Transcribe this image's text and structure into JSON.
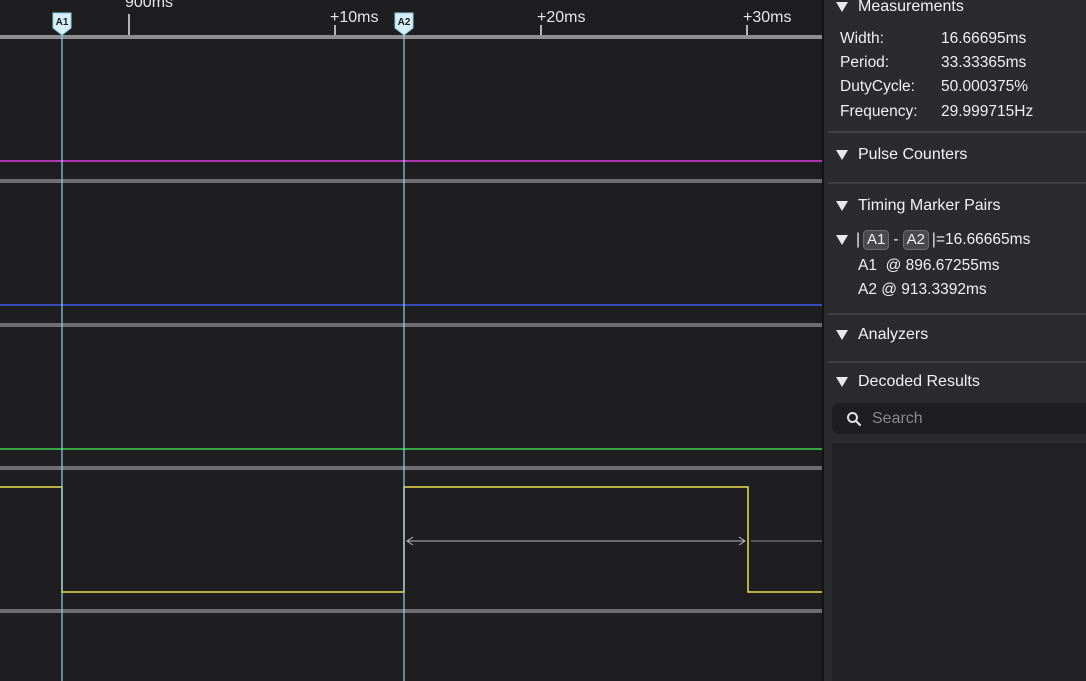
{
  "timeline": {
    "ticks": [
      "900ms",
      "+10ms",
      "+20ms",
      "+30ms"
    ],
    "markers": [
      "A1",
      "A2"
    ]
  },
  "channels": {
    "colors": [
      "#e23ee8",
      "#3d5ce8",
      "#3fd04a",
      "#e8e04a"
    ]
  },
  "panel": {
    "measurements": {
      "title": "Measurements",
      "rows": [
        {
          "label": "Width:",
          "value": "16.66695ms"
        },
        {
          "label": "Period:",
          "value": "33.33365ms"
        },
        {
          "label": "DutyCycle:",
          "value": "50.000375%"
        },
        {
          "label": "Frequency:",
          "value": "29.999715Hz"
        }
      ]
    },
    "pulse_counters": {
      "title": "Pulse Counters"
    },
    "timing_marker_pairs": {
      "title": "Timing Marker Pairs",
      "pair": {
        "bar_open": "|",
        "a": "A1",
        "dash": "-",
        "b": "A2",
        "bar_close": "|",
        "equals": "=",
        "delta": "16.66665ms"
      },
      "a1_line": "A1  @ 896.67255ms",
      "a2_line": "A2 @ 913.3392ms"
    },
    "analyzers": {
      "title": "Analyzers"
    },
    "decoded_results": {
      "title": "Decoded Results",
      "search_placeholder": "Search"
    }
  }
}
